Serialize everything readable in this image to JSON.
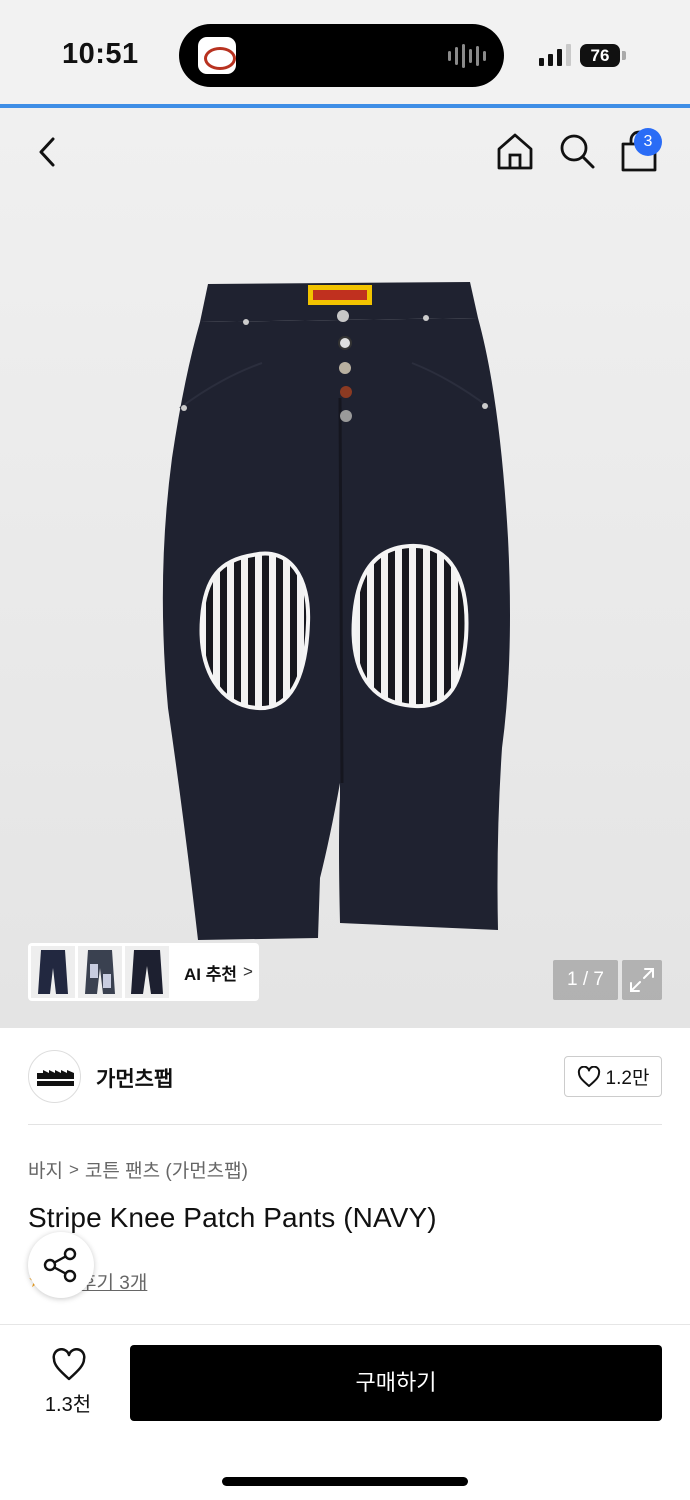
{
  "status_bar": {
    "time": "10:51",
    "battery": "76"
  },
  "nav": {
    "cart_count": "3",
    "icons": [
      "back-arrow-icon",
      "home-icon",
      "search-icon",
      "shopping-bag-icon"
    ]
  },
  "gallery": {
    "pager": "1 / 7",
    "ai_label": "AI 추천",
    "ai_chevron": ">"
  },
  "brand": {
    "name": "가먼츠팹",
    "logo_text": "GARMENTS FAB",
    "likes": "1.2만"
  },
  "product": {
    "breadcrumb": [
      "바지",
      "코튼 팬츠 (가먼츠팹)"
    ],
    "breadcrumb_sep": ">",
    "title": "Stripe Knee Patch Pants (NAVY)",
    "review_text": "후기 3개"
  },
  "bottom_bar": {
    "like_count": "1.3천",
    "buy_label": "구매하기"
  },
  "colors": {
    "accent": "#2a6cf6",
    "buy_button": "#000000",
    "pants": "#1f2230"
  }
}
